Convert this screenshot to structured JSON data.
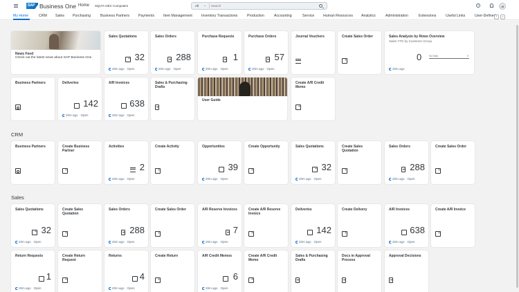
{
  "shell": {
    "brand": "Business One",
    "logo_text": "SAP",
    "home": "Home",
    "company": "SQLTA OEC Computers",
    "search_scope": "All",
    "search_placeholder": "Search",
    "avatar_initials": "JB"
  },
  "tabs": [
    "My Home",
    "CRM",
    "Sales",
    "Purchasing",
    "Business Partners",
    "Payments",
    "Item Management",
    "Inventory Transactions",
    "Production",
    "Accounting",
    "Service",
    "Human Resources",
    "Analytics",
    "Administration",
    "Extensions",
    "Useful Links",
    "User-Defined"
  ],
  "sections": {
    "crm": "CRM",
    "sales": "Sales"
  },
  "tiles": {
    "news_title": "News Feed",
    "news_sub": "Check out the latest news about SAP Business One",
    "sales_quotations": "Sales Quotations",
    "sales_orders": "Sales Orders",
    "purchase_requests": "Purchase Requests",
    "purchase_orders": "Purchase Orders",
    "journal_vouchers": "Journal Vouchers",
    "create_sales_order": "Create Sales Order",
    "sales_analysis": "Sales Analysis by Rows Overview",
    "sales_analysis_sub": "Sales YTD by Customer Group",
    "no_data": "No Data",
    "zero": "0",
    "business_partners": "Business Partners",
    "deliveries": "Deliveries",
    "ar_invoices": "A/R Invoices",
    "sales_purchasing_drafts": "Sales & Purchasing Drafts",
    "user_guide": "User Guide",
    "create_ar_credit_memo": "Create A/R Credit Memo",
    "create_business_partner": "Create Business Partner",
    "activities": "Activities",
    "create_activity": "Create Activity",
    "opportunities": "Opportunities",
    "create_opportunity": "Create Opportunity",
    "create_sales_quotation": "Create Sales Quotation",
    "ar_reserve_invoices": "A/R Reserve Invoices",
    "create_ar_reserve_invoice": "Create A/R Reserve Invoice",
    "create_delivery": "Create Delivery",
    "create_ar_invoice": "Create A/R Invoice",
    "return_requests": "Return Requests",
    "create_return_request": "Create Return Request",
    "returns": "Returns",
    "create_return": "Create Return",
    "ar_credit_memos": "A/R Credit Memos",
    "docs_in_approval": "Docs in Approval Process",
    "approval_decisions": "Approval Decisions"
  },
  "kpis": {
    "sales_quotations": "32",
    "sales_orders": "288",
    "purchase_requests": "1",
    "purchase_orders": "57",
    "sales_analysis": "0",
    "deliveries": "142",
    "ar_invoices": "638",
    "activities": "2",
    "opportunities": "39",
    "ar_reserve_invoices": "7",
    "return_requests": "1",
    "returns": "4",
    "ar_credit_memos": "6"
  },
  "footer": {
    "age": "20m ago",
    "status": "Open"
  }
}
